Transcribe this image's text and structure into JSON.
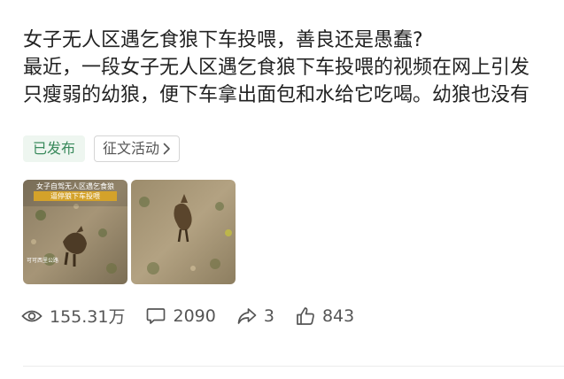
{
  "post": {
    "title": "女子无人区遇乞食狼下车投喂，善良还是愚蠢?",
    "line2": "最近，一段女子无人区遇乞食狼下车投喂的视频在网上引发",
    "line3": "只瘦弱的幼狼，便下车拿出面包和水给它吃喝。幼狼也没有"
  },
  "tags": {
    "status": "已发布",
    "activity": "征文活动"
  },
  "thumbnails": [
    {
      "icon": "video-frame-wolf-image",
      "caption_top": "女子自驾无人区遇乞食狼",
      "caption_yellow": "逼停狼下车投喂",
      "caption_bottom": "可可西里公路"
    },
    {
      "icon": "video-frame-wolf-image"
    }
  ],
  "stats": {
    "views": "155.31万",
    "comments": "2090",
    "shares": "3",
    "likes": "843"
  },
  "colors": {
    "status_tag_bg": "#eef6f0",
    "status_tag_text": "#3a8a5c",
    "text": "#222222",
    "meta": "#555555"
  }
}
